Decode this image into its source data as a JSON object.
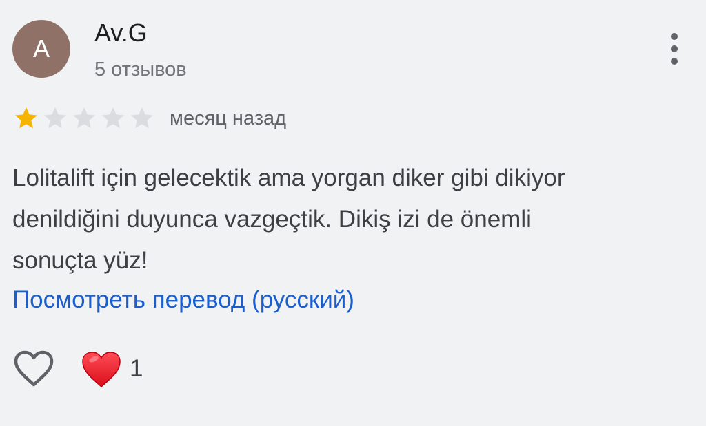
{
  "review": {
    "author": {
      "avatar_letter": "A",
      "name": "Av.G",
      "review_count": "5 отзывов"
    },
    "rating": {
      "value": 1,
      "max": 5,
      "filled_color": "#f6b400",
      "empty_color": "#dadce0"
    },
    "date": "месяц назад",
    "text": "Lolitalift için gelecektik ama yorgan diker gibi dikiyor\ndenildiğini duyunca vazgeçtik. Dikiş izi de önemli\nsonuçta yüz!",
    "translate_link": "Посмотреть перевод (русский)",
    "reactions": {
      "like_icon": "heart-outline-icon",
      "reaction_icon": "red-heart-emoji",
      "count": "1"
    },
    "menu_icon": "more-vertical-icon"
  },
  "colors": {
    "background": "#f1f2f4",
    "avatar": "#8f7167",
    "link": "#1a5fd0"
  }
}
